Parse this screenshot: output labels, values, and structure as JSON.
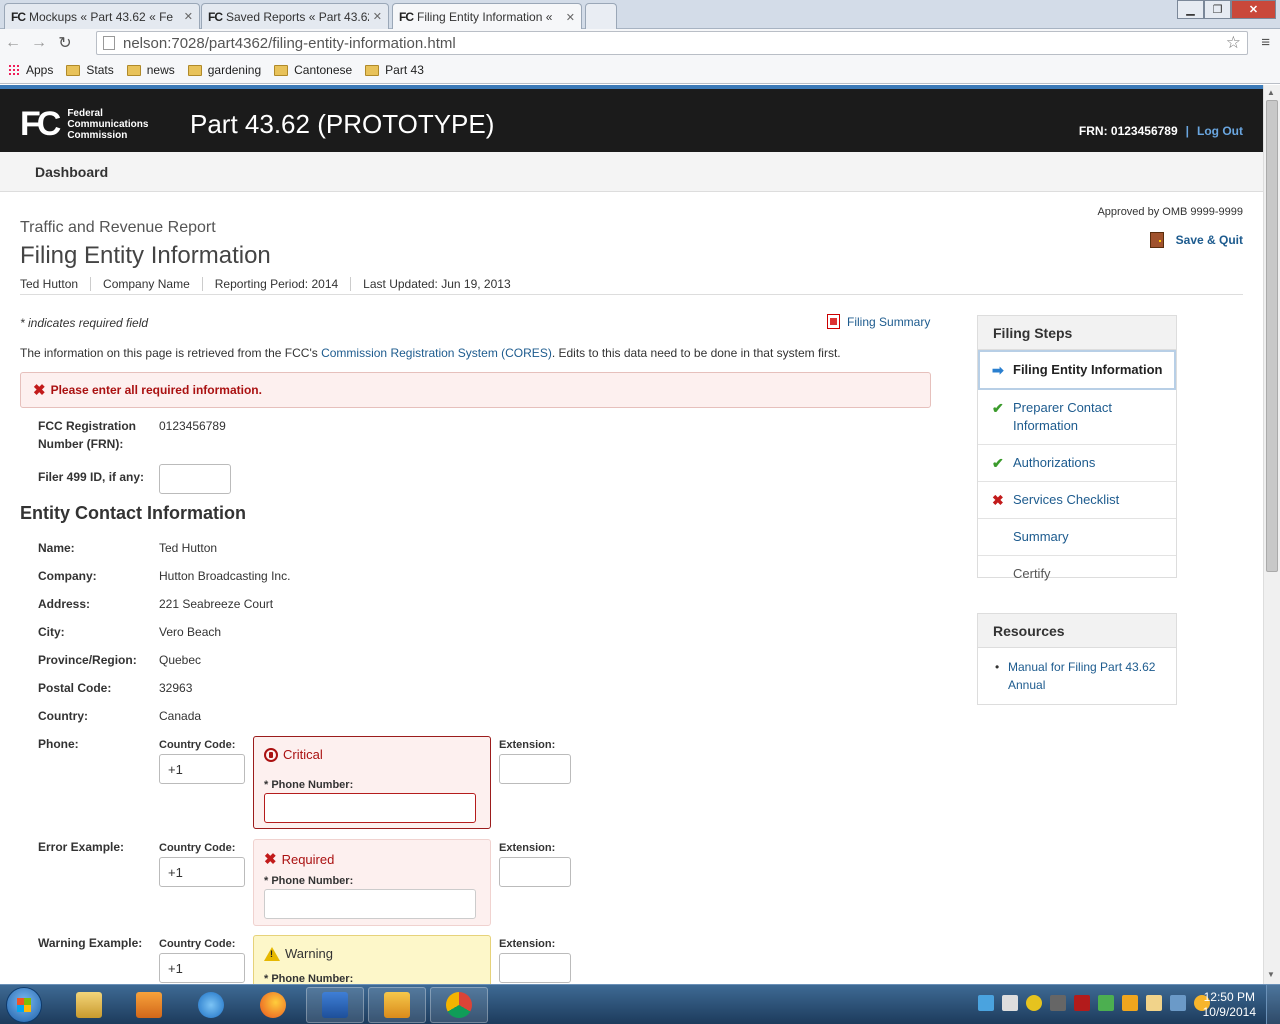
{
  "browser": {
    "tabs": [
      {
        "title": "Mockups « Part 43.62 « Fe",
        "active": false
      },
      {
        "title": "Saved Reports « Part 43.62",
        "active": false
      },
      {
        "title": "Filing Entity Information «",
        "active": true
      }
    ],
    "tab_icon_text": "FC",
    "url": "nelson:7028/part4362/filing-entity-information.html",
    "bookmarks": [
      "Apps",
      "Stats",
      "news",
      "gardening",
      "Cantonese",
      "Part 43"
    ]
  },
  "header": {
    "logo_mark": "FC",
    "agency_line1": "Federal",
    "agency_line2": "Communications",
    "agency_line3": "Commission",
    "site_title": "Part 43.62 (PROTOTYPE)",
    "frn_label": "FRN: 0123456789",
    "separator": "|",
    "logout": "Log Out"
  },
  "nav": {
    "dashboard": "Dashboard"
  },
  "page": {
    "approved": "Approved by OMB 9999-9999",
    "save_quit": "Save & Quit",
    "kicker": "Traffic and Revenue Report",
    "title": "Filing Entity Information",
    "meta": {
      "user": "Ted Hutton",
      "company": "Company Name",
      "period": "Reporting Period: 2014",
      "updated": "Last Updated: Jun 19, 2013"
    },
    "required_note": "* indicates required field",
    "filing_summary": "Filing Summary",
    "info_prefix": "The information on this page is retrieved from the FCC's ",
    "info_link": "Commission Registration System (CORES)",
    "info_suffix": ". Edits to this data need to be done in that system first.",
    "error_alert": "Please enter all required information."
  },
  "form": {
    "frn_label_1": "FCC Registration",
    "frn_label_2": "Number (FRN):",
    "frn_value": "0123456789",
    "filer_label": "Filer 499 ID, if any:",
    "filer_value": "",
    "section_title": "Entity Contact Information",
    "contact": [
      {
        "label": "Name:",
        "value": "Ted Hutton"
      },
      {
        "label": "Company:",
        "value": "Hutton Broadcasting Inc."
      },
      {
        "label": "Address:",
        "value": "221 Seabreeze Court"
      },
      {
        "label": "City:",
        "value": "Vero Beach"
      },
      {
        "label": "Province/Region:",
        "value": "Quebec"
      },
      {
        "label": "Postal Code:",
        "value": "32963"
      },
      {
        "label": "Country:",
        "value": "Canada"
      }
    ],
    "phones": [
      {
        "label": "Phone:",
        "country_code_label": "Country Code:",
        "country_code": "+1",
        "status": "Critical",
        "phone_label": "* Phone Number:",
        "phone_value": "",
        "extension_label": "Extension:",
        "extension_value": ""
      },
      {
        "label": "Error Example:",
        "country_code_label": "Country Code:",
        "country_code": "+1",
        "status": "Required",
        "phone_label": "* Phone Number:",
        "phone_value": "",
        "extension_label": "Extension:",
        "extension_value": ""
      },
      {
        "label": "Warning Example:",
        "country_code_label": "Country Code:",
        "country_code": "+1",
        "status": "Warning",
        "phone_label": "* Phone Number:",
        "phone_value": "",
        "extension_label": "Extension:",
        "extension_value": ""
      }
    ]
  },
  "sidebar": {
    "steps_title": "Filing Steps",
    "steps": [
      {
        "label": "Filing Entity Information",
        "state": "current"
      },
      {
        "label": "Preparer Contact Information",
        "state": "complete"
      },
      {
        "label": "Authorizations",
        "state": "complete"
      },
      {
        "label": "Services Checklist",
        "state": "error"
      },
      {
        "label": "Summary",
        "state": "pending"
      },
      {
        "label": "Certify",
        "state": "pending"
      }
    ],
    "resources_title": "Resources",
    "resources": [
      "Manual for Filing Part 43.62 Annual"
    ]
  },
  "taskbar": {
    "time": "12:50 PM",
    "date": "10/9/2014"
  },
  "colors": {
    "header_bg": "#1b1b1b",
    "link": "#1d5b8e",
    "error": "#a11111",
    "success": "#3b9b2c",
    "warning_bg": "#fdf7c9"
  }
}
